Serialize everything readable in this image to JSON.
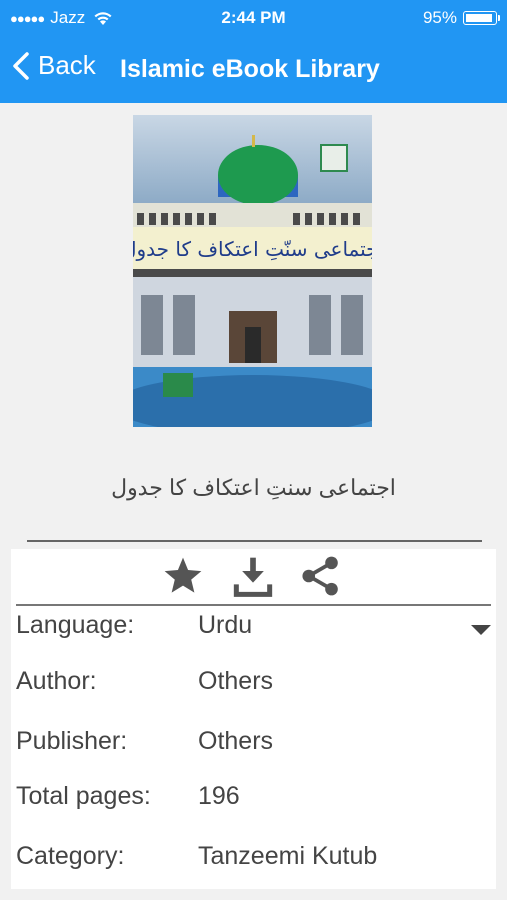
{
  "status_bar": {
    "carrier": "Jazz",
    "time": "2:44 PM",
    "battery": "95%",
    "battery_level": 0.95
  },
  "nav": {
    "back_label": "Back",
    "title": "Islamic eBook Library"
  },
  "book": {
    "cover_title": "اجتماعی سنّتِ اعتکاف کا جدول",
    "title": "اجتماعی سنتِ اعتکاف کا جدول"
  },
  "actions": {
    "favorite_icon": "star-icon",
    "download_icon": "download-icon",
    "share_icon": "share-icon"
  },
  "details": [
    {
      "label": "Language:",
      "value": "Urdu"
    },
    {
      "label": "Author:",
      "value": "Others"
    },
    {
      "label": "Publisher:",
      "value": "Others"
    },
    {
      "label": "Total pages:",
      "value": "196"
    },
    {
      "label": "Category:",
      "value": "Tanzeemi Kutub"
    }
  ],
  "colors": {
    "header": "#2196f3",
    "panel": "#ffffff",
    "background": "#f1f1f1"
  }
}
